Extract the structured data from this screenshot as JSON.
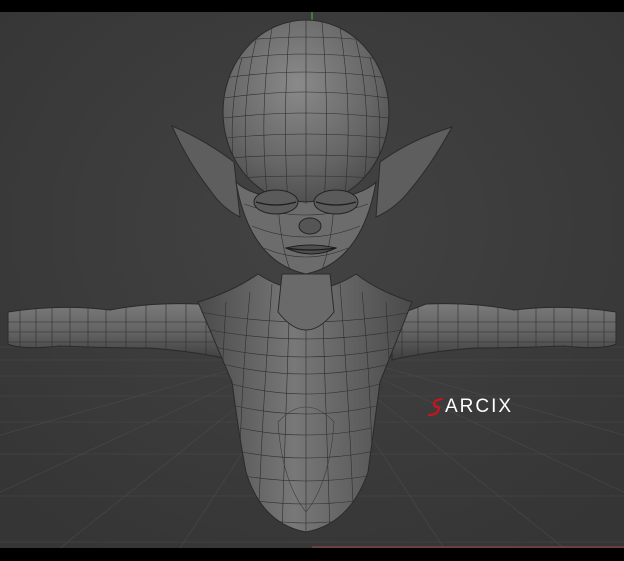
{
  "watermark": {
    "text": "ARCIX",
    "logo_icon": "stylized-red-s-icon",
    "colors": {
      "accent": "#c8141c",
      "text": "#ffffff"
    }
  },
  "viewport": {
    "background": "#3b3b3b",
    "grid_color": "#4a4a4a",
    "y_axis_color": "#55c055",
    "x_axis_color": "#c05555",
    "mesh_fill": "#6c6c6c",
    "mesh_wire": "#2a2a2a"
  }
}
